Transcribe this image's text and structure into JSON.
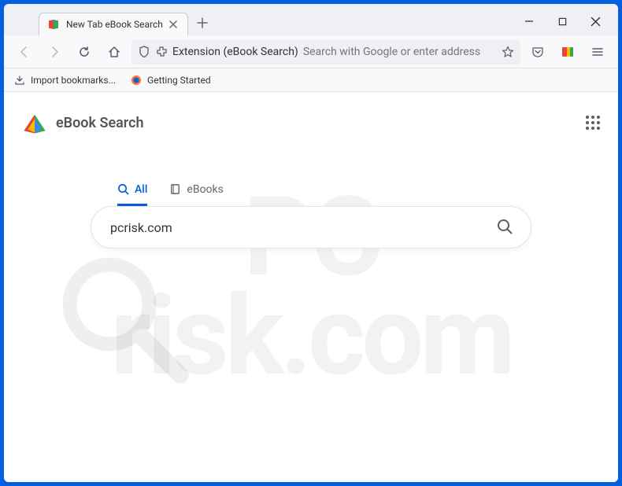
{
  "window": {
    "tab_title": "New Tab eBook Search"
  },
  "urlbar": {
    "extension_label": "Extension (eBook Search)",
    "placeholder": "Search with Google or enter address"
  },
  "bookmarks": {
    "import": "Import bookmarks...",
    "getting_started": "Getting Started"
  },
  "page": {
    "brand": "eBook Search",
    "tabs": {
      "all": "All",
      "ebooks": "eBooks"
    },
    "search_value": "pcrisk.com"
  }
}
